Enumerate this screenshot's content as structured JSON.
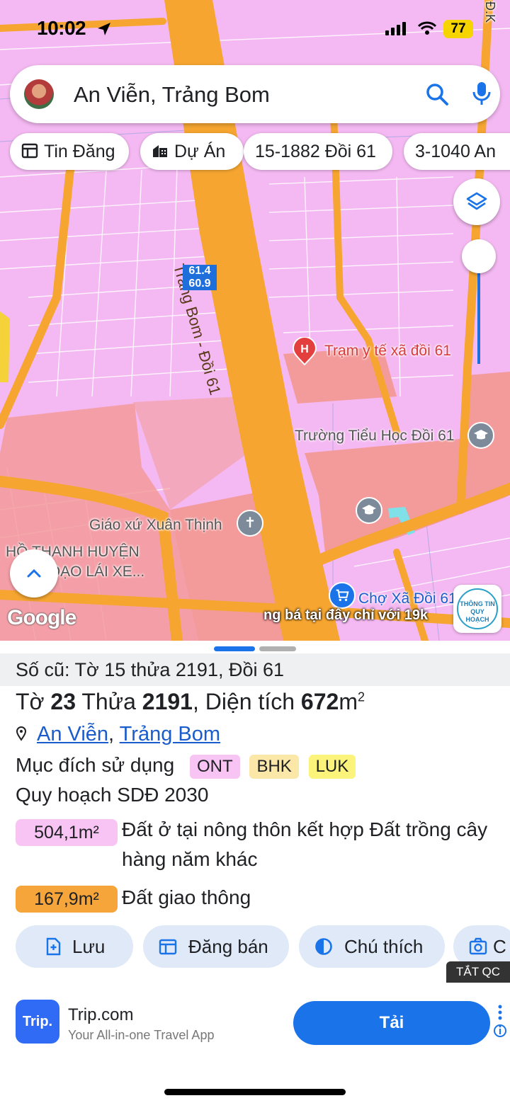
{
  "status_bar": {
    "time": "10:02",
    "battery": "77"
  },
  "search": {
    "query": "An Viễn, Trảng Bom"
  },
  "chips": [
    {
      "label": "Tin Đăng",
      "icon": "listing-icon"
    },
    {
      "label": "Dự Án",
      "icon": "building-icon"
    },
    {
      "label": "15-1882 Đồi 61"
    },
    {
      "label": "3-1040 An"
    }
  ],
  "map": {
    "road_name": "Trảng Bom - Đồi 61",
    "parcel_label": {
      "line1": "61.4",
      "line2": "60.9"
    },
    "pois": {
      "health": "Trạm y tế xã đồi 61",
      "school": "Trường Tiểu Học Đồi 61",
      "church": "Giáo xứ Xuân Thịnh",
      "driving": "HỒ THANH HUYỆN",
      "driving2": "ĐẠO LÁI XE...",
      "market": "Chợ Xã Đồi 61",
      "top_right": "Đ.K"
    },
    "google_logo": "Google",
    "ad_ticker": "ng bá tại đây chỉ với 19k",
    "badge": "THÔNG TIN QUY HOẠCH"
  },
  "sheet": {
    "old_id": "Số cũ: Tờ 15 thửa 2191, Đồi 61",
    "title": {
      "to_label": "Tờ",
      "to": "23",
      "thua_label": "Thửa",
      "thua": "2191",
      "area_label": ", Diện tích",
      "area": "672",
      "unit": "m",
      "exp": "2"
    },
    "address": {
      "commune": "An Viễn",
      "sep": ",",
      "district": "Trảng Bom"
    },
    "purpose_label": "Mục đích sử dụng",
    "purpose_tags": [
      {
        "code": "ONT",
        "bg": "#f8c4f3"
      },
      {
        "code": "BHK",
        "bg": "#fbe7a8"
      },
      {
        "code": "LUK",
        "bg": "#fbf37a"
      }
    ],
    "plan_label": "Quy hoạch SDĐ 2030",
    "areas": [
      {
        "value": "504,1m²",
        "desc": "Đất ở tại nông thôn kết hợp Đất trồng cây hàng năm khác",
        "bg": "#f8c4f3"
      },
      {
        "value": "167,9m²",
        "desc": "Đất giao thông",
        "bg": "#f5a53a"
      }
    ],
    "actions": [
      {
        "label": "Lưu",
        "icon": "save-icon"
      },
      {
        "label": "Đăng bán",
        "icon": "post-icon"
      },
      {
        "label": "Chú thích",
        "icon": "legend-icon"
      },
      {
        "label": "C",
        "icon": "camera-icon"
      }
    ]
  },
  "ad": {
    "close_label": "TẮT QC",
    "logo_text": "Trip.",
    "title": "Trip.com",
    "subtitle": "Your All-in-one Travel App",
    "cta": "Tải"
  }
}
